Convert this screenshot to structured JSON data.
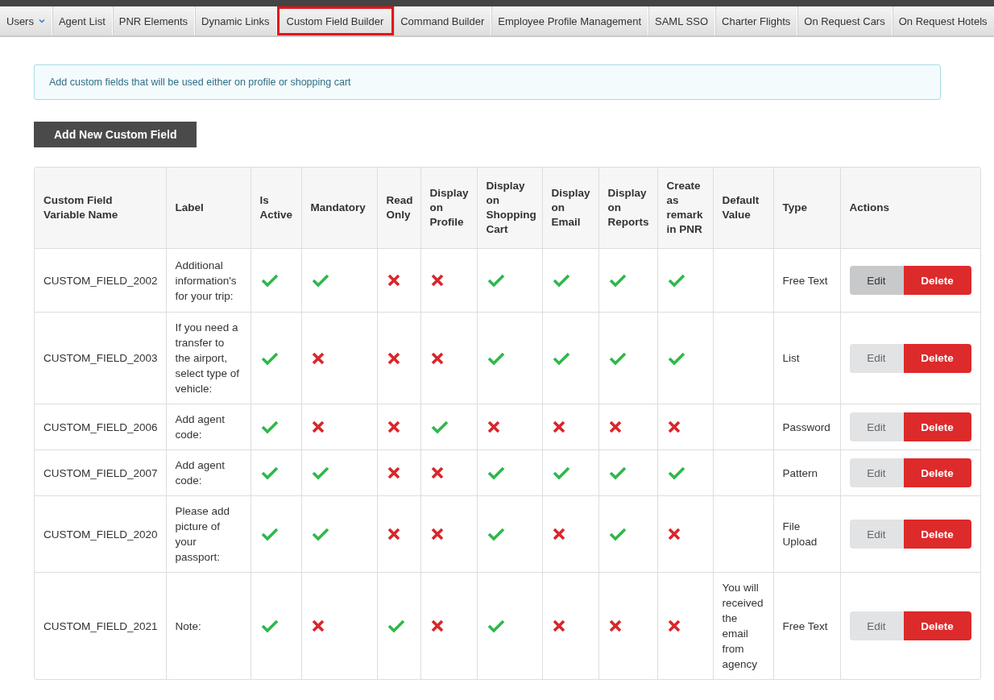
{
  "nav": [
    {
      "label": "Users",
      "kind": "dropdown",
      "selected": false
    },
    {
      "label": "Agent List",
      "kind": "link",
      "selected": false
    },
    {
      "label": "PNR Elements",
      "kind": "link",
      "selected": false
    },
    {
      "label": "Dynamic Links",
      "kind": "link",
      "selected": false
    },
    {
      "label": "Custom Field Builder",
      "kind": "link",
      "selected": true
    },
    {
      "label": "Command Builder",
      "kind": "link",
      "selected": false
    },
    {
      "label": "Employee Profile Management",
      "kind": "link",
      "selected": false
    },
    {
      "label": "SAML SSO",
      "kind": "link",
      "selected": false
    },
    {
      "label": "Charter Flights",
      "kind": "link",
      "selected": false
    },
    {
      "label": "On Request Cars",
      "kind": "link",
      "selected": false
    },
    {
      "label": "On Request Hotels",
      "kind": "link",
      "selected": false
    }
  ],
  "info": "Add custom fields that will be used either on profile or shopping cart",
  "add_button": "Add New Custom Field",
  "table": {
    "columns": [
      "Custom Field Variable Name",
      "Label",
      "Is Active",
      "Mandatory",
      "Read Only",
      "Display on Profile",
      "Display on Shopping Cart",
      "Display on Email",
      "Display on Reports",
      "Create as remark in PNR",
      "Default Value",
      "Type",
      "Actions"
    ],
    "rows": [
      {
        "name": "CUSTOM_FIELD_2002",
        "label": "Additional information's for your trip:",
        "flags": [
          true,
          true,
          false,
          false,
          true,
          true,
          true,
          true
        ],
        "default_value": "",
        "type": "Free Text",
        "edit": "Edit",
        "edit_hovered": true,
        "delete": "Delete"
      },
      {
        "name": "CUSTOM_FIELD_2003",
        "label": "If you need a transfer to the airport, select type of vehicle:",
        "flags": [
          true,
          false,
          false,
          false,
          true,
          true,
          true,
          true
        ],
        "type": "List",
        "edit": "Edit",
        "edit_hovered": false,
        "delete": "Delete"
      },
      {
        "name": "CUSTOM_FIELD_2006",
        "label": "Add agent code:",
        "flags": [
          true,
          false,
          false,
          true,
          false,
          false,
          false,
          false
        ],
        "type": "Password",
        "edit": "Edit",
        "edit_hovered": false,
        "delete": "Delete"
      },
      {
        "name": "CUSTOM_FIELD_2007",
        "label": "Add agent code:",
        "flags": [
          true,
          true,
          false,
          false,
          true,
          true,
          true,
          true
        ],
        "type": "Pattern",
        "edit": "Edit",
        "edit_hovered": false,
        "delete": "Delete"
      },
      {
        "name": "CUSTOM_FIELD_2020",
        "label": "Please add picture of your passport:",
        "flags": [
          true,
          true,
          false,
          false,
          true,
          false,
          true,
          false
        ],
        "type": "File Upload",
        "edit": "Edit",
        "edit_hovered": false,
        "delete": "Delete"
      },
      {
        "name": "CUSTOM_FIELD_2021",
        "label": "Note:",
        "flags": [
          true,
          false,
          true,
          false,
          true,
          false,
          false,
          false
        ],
        "default_value": "You will received the email from agency",
        "type": "Free Text",
        "edit": "Edit",
        "edit_hovered": false,
        "delete": "Delete"
      }
    ]
  }
}
